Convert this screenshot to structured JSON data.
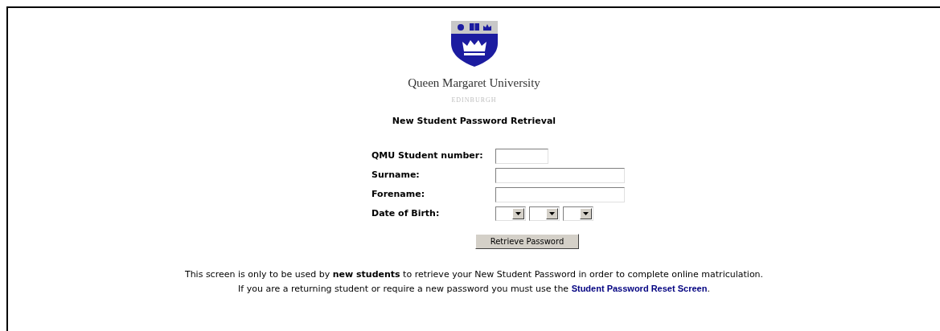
{
  "logo": {
    "name": "Queen Margaret University",
    "place": "EDINBURGH"
  },
  "title": "New Student Password Retrieval",
  "fields": [
    {
      "kind": "number",
      "label": "QMU Student number:"
    },
    {
      "kind": "text",
      "label": "Surname:"
    },
    {
      "kind": "text",
      "label": "Forename:"
    },
    {
      "kind": "date",
      "label": "Date of Birth:"
    }
  ],
  "button": "Retrieve Password",
  "notice": {
    "line1": "This screen is only to be used by **new students** to retrieve your New Student Password in order to complete online matriculation.",
    "line2_before": "If you are a returning student or require a new password you must use the",
    "link": "Student Password Reset Screen",
    "line2_after": "."
  }
}
